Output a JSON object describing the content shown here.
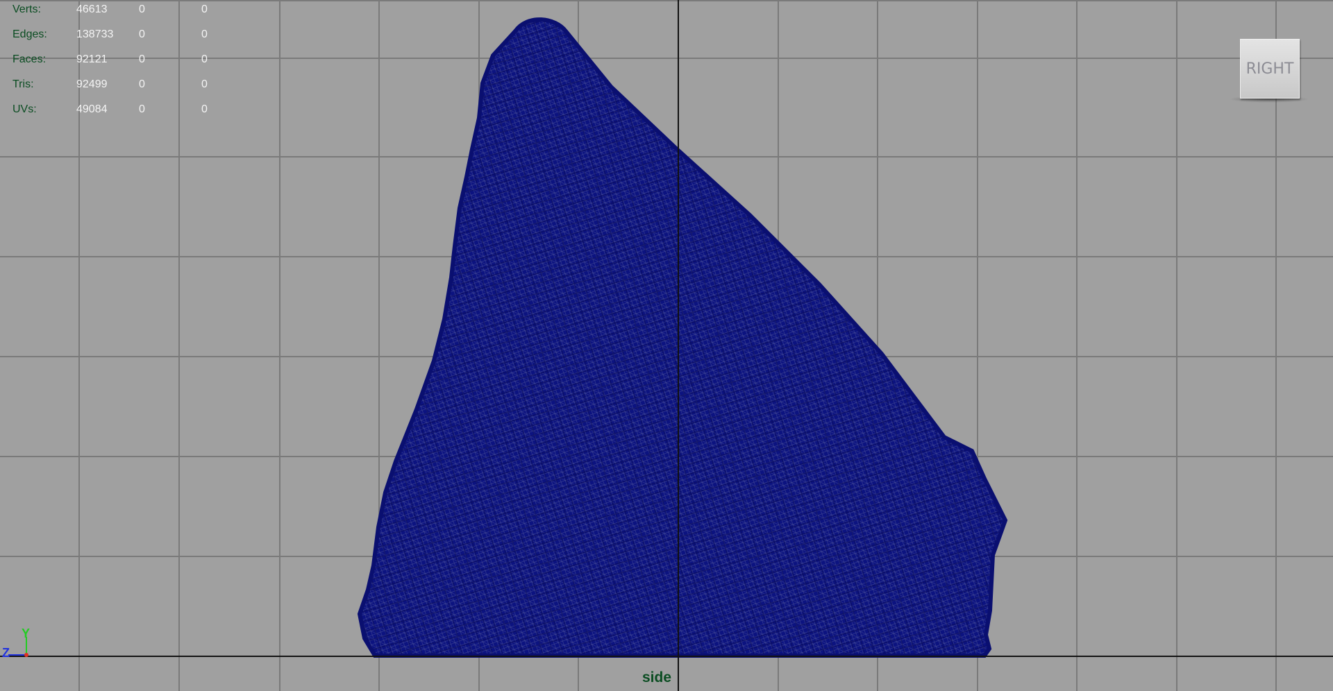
{
  "hud": {
    "rows": [
      {
        "label": "Verts:",
        "v1": "46613",
        "v2": "0",
        "v3": "0"
      },
      {
        "label": "Edges:",
        "v1": "138733",
        "v2": "0",
        "v3": "0"
      },
      {
        "label": "Faces:",
        "v1": "92121",
        "v2": "0",
        "v3": "0"
      },
      {
        "label": "Tris:",
        "v1": "92499",
        "v2": "0",
        "v3": "0"
      },
      {
        "label": "UVs:",
        "v1": "49084",
        "v2": "0",
        "v3": "0"
      }
    ]
  },
  "view_cube": {
    "label": "RIGHT"
  },
  "camera": {
    "label": "side"
  },
  "axis_gizmo": {
    "y": "Y",
    "z": "Z"
  },
  "colors": {
    "background": "#a0a0a0",
    "grid": "#7a7a7a",
    "axis": "#111111",
    "mesh": "#0a107a",
    "hud_label": "#0b4d22",
    "hud_value": "#f4f4f4",
    "gizmo_y": "#22cc22",
    "gizmo_z": "#2233dd",
    "gizmo_x": "#dd3322"
  }
}
